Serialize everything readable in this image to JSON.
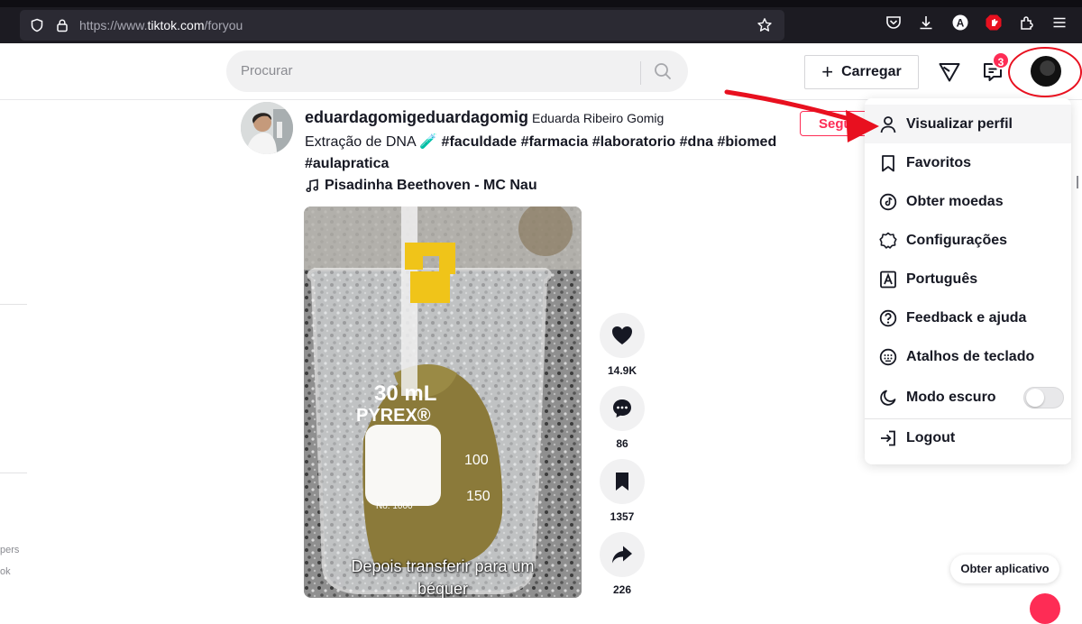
{
  "browser": {
    "url_prefix": "https://www.",
    "url_host": "tiktok.com",
    "url_path": "/foryou"
  },
  "header": {
    "search_placeholder": "Procurar",
    "upload_label": "Carregar",
    "inbox_badge": "3"
  },
  "sidebar_fragments": [
    "pers",
    "ok"
  ],
  "post": {
    "username": "eduardagomigeduardagomig",
    "nickname": "Eduarda Ribeiro Gomig",
    "caption_text": "Extração de DNA 🧪 ",
    "hashtags_line1": "#faculdade #farmacia #laboratorio #dna #biomed",
    "hashtags_line2": "#aulapratica",
    "music": "Pisadinha Beethoven - MC Nau",
    "follow_label": "Seguir",
    "subtitle_line1": "Depois transferir para um",
    "subtitle_line2": "béquer",
    "beaker_text": "30 mL",
    "beaker_brand": "PYREX®",
    "beaker_marks": [
      "100",
      "150"
    ],
    "beaker_no": "No. 1000",
    "likes": "14.9K",
    "comments": "86",
    "saves": "1357",
    "shares": "226"
  },
  "menu": {
    "items": [
      {
        "label": "Visualizar perfil",
        "icon": "user-icon"
      },
      {
        "label": "Favoritos",
        "icon": "bookmark-icon"
      },
      {
        "label": "Obter moedas",
        "icon": "coin-icon"
      },
      {
        "label": "Configurações",
        "icon": "gear-icon"
      },
      {
        "label": "Português",
        "icon": "language-icon"
      },
      {
        "label": "Feedback e ajuda",
        "icon": "help-icon"
      },
      {
        "label": "Atalhos de teclado",
        "icon": "keyboard-icon"
      },
      {
        "label": "Modo escuro",
        "icon": "moon-icon"
      },
      {
        "label": "Logout",
        "icon": "logout-icon"
      }
    ],
    "dark_mode_on": false
  },
  "get_app_label": "Obter aplicativo",
  "colors": {
    "brand": "#fe2c55",
    "annotation": "#e8101f",
    "browser_chrome": "#1c1b22"
  }
}
